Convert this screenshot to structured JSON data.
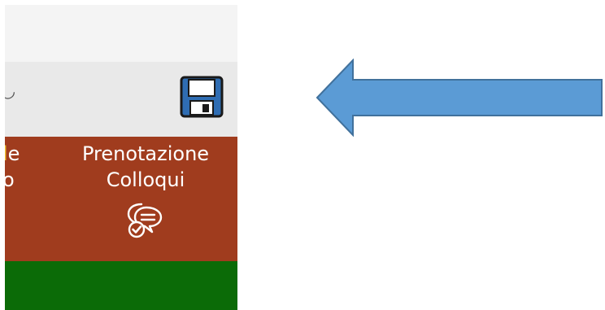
{
  "menu": {
    "prev_item": {
      "line1": "le",
      "line2": "o"
    },
    "item": {
      "line1": "Prenotazione",
      "line2": "Colloqui",
      "icon": "chat-bubbles-check-icon"
    }
  },
  "toolbar": {
    "save_icon": "save-floppy-icon"
  },
  "annotation": {
    "arrow_icon": "left-arrow-icon",
    "arrow_color": "#5b9bd5"
  },
  "colors": {
    "menu_band": "#a03c1e",
    "green_band": "#0b6b07",
    "toolbar": "#e9e9e9",
    "topbar": "#f4f4f4"
  }
}
